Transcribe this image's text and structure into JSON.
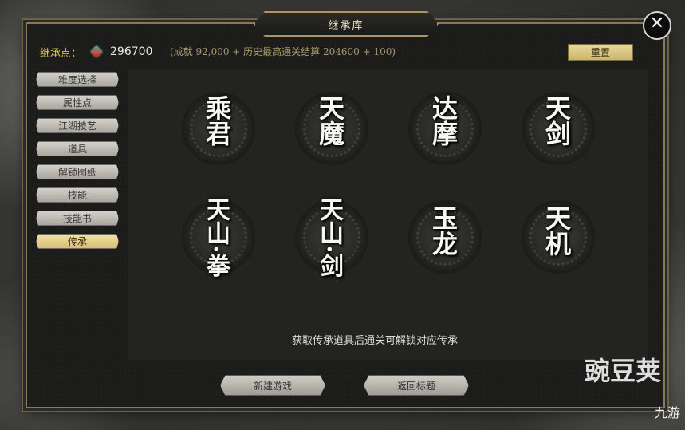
{
  "window": {
    "title": "继承库",
    "close_icon": "✕"
  },
  "points": {
    "label": "继承点：",
    "value": "296700",
    "detail": "(成就 92,000 + 历史最高通关结算 204600 + 100)",
    "icon": "gem-icon"
  },
  "reset_label": "重置",
  "sidebar": {
    "items": [
      {
        "label": "难度选择"
      },
      {
        "label": "属性点"
      },
      {
        "label": "江湖技艺"
      },
      {
        "label": "道具"
      },
      {
        "label": "解锁图纸"
      },
      {
        "label": "技能"
      },
      {
        "label": "技能书"
      },
      {
        "label": "传承",
        "active": true
      }
    ]
  },
  "legacies": [
    {
      "name": "乘君"
    },
    {
      "name": "天魔"
    },
    {
      "name": "达摩"
    },
    {
      "name": "天剑"
    },
    {
      "name": "天山·拳"
    },
    {
      "name": "天山·剑"
    },
    {
      "name": "玉龙"
    },
    {
      "name": "天机"
    }
  ],
  "hint": "获取传承道具后通关可解锁对应传承",
  "buttons": {
    "new_game": "新建游戏",
    "return_title": "返回标题"
  },
  "watermark": {
    "main": "豌豆荚",
    "sub": "九游"
  }
}
